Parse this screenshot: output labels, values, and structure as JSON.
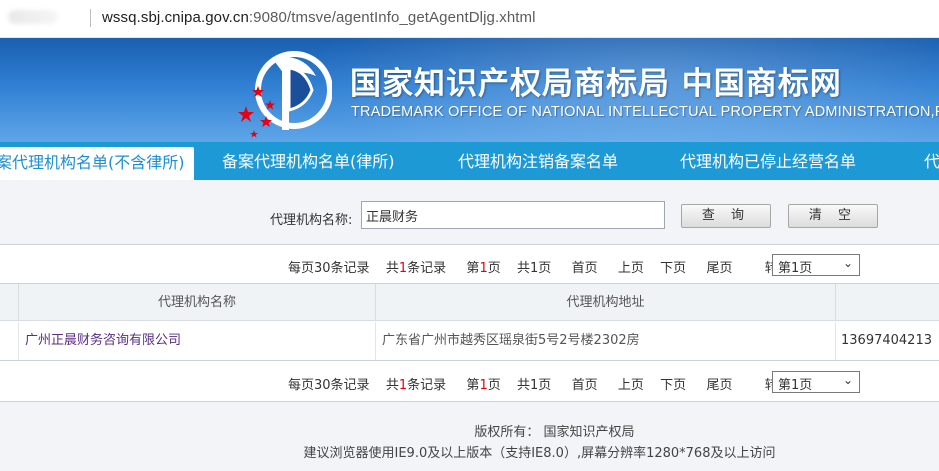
{
  "browser": {
    "url_host": "wssq.sbj.cnipa.gov.cn",
    "url_path": ":9080/tmsve/agentInfo_getAgentDljg.xhtml"
  },
  "banner": {
    "title": "国家知识产权局商标局 中国商标网",
    "subtitle": "TRADEMARK OFFICE OF NATIONAL INTELLECTUAL PROPERTY ADMINISTRATION,PRC"
  },
  "tabs": [
    {
      "label": "案代理机构名单(不含律所)",
      "active": true
    },
    {
      "label": "备案代理机构名单(律所)",
      "active": false
    },
    {
      "label": "代理机构注销备案名单",
      "active": false
    },
    {
      "label": "代理机构已停止经营名单",
      "active": false
    },
    {
      "label": "代",
      "active": false
    }
  ],
  "search": {
    "label": "代理机构名称:",
    "value": "正晨财务",
    "query_button": "查 询",
    "clear_button": "清 空"
  },
  "pager": {
    "per_page": "每页30条记录",
    "total_prefix": "共",
    "total_count": "1",
    "total_suffix": "条记录",
    "page_prefix": "第",
    "current_page": "1",
    "page_suffix": "页",
    "total_pages": "共1页",
    "first": "首页",
    "prev": "上页",
    "next": "下页",
    "last": "尾页",
    "goto_label": "转到：",
    "goto_value": "第1页"
  },
  "table": {
    "headers": [
      "代理机构名称",
      "代理机构地址"
    ],
    "rows": [
      {
        "name": "广州正晨财务咨询有限公司",
        "address": "广东省广州市越秀区瑶泉街5号2号楼2302房",
        "phone": "13697404213"
      }
    ]
  },
  "footer": {
    "copyright": "版权所有：  国家知识产权局",
    "browser_note": "建议浏览器使用IE9.0及以上版本（支持IE8.0）,屏幕分辨率1280*768及以上访问"
  },
  "colors": {
    "banner_blue": "#2f7fd3",
    "tab_bar": "#1d9ad6",
    "link_purple": "#5a2d82",
    "highlight_red": "#e60012"
  }
}
